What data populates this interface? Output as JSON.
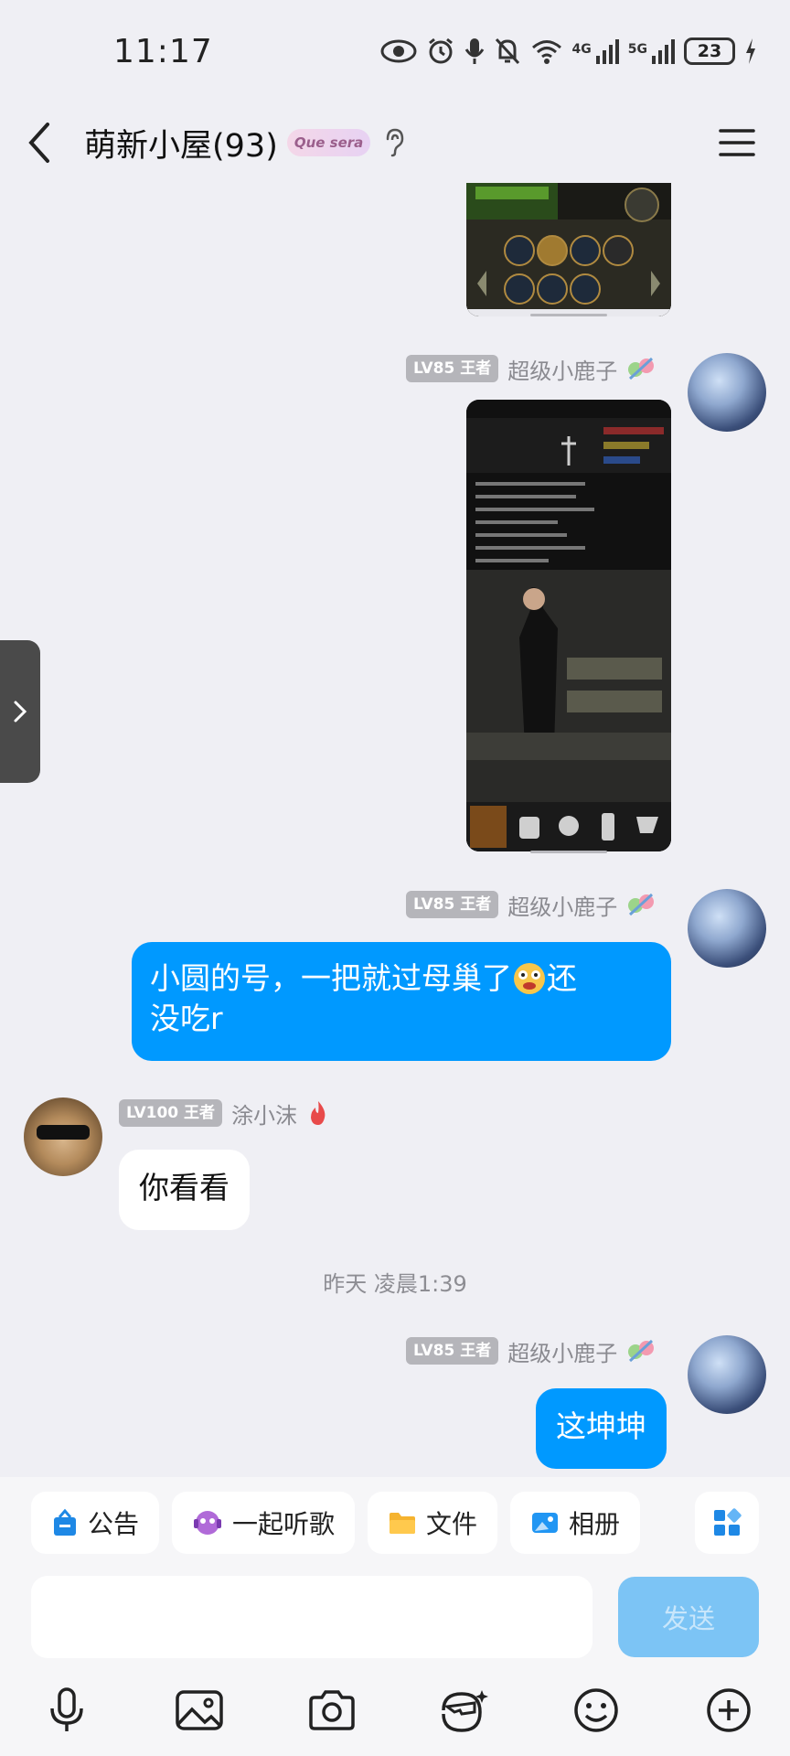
{
  "status_bar": {
    "time": "11:17",
    "network_1": "4G",
    "network_2": "5G",
    "battery": "23"
  },
  "header": {
    "back_icon": "chevron-left-icon",
    "title": "萌新小屋(93)",
    "badge_text": "Que sera",
    "ear_icon": "ear-icon",
    "menu_icon": "hamburger-menu-icon"
  },
  "messages": [
    {
      "type": "image",
      "direction": "out",
      "description_icon": "game-screenshot"
    },
    {
      "type": "image",
      "direction": "out",
      "level": "LV85 王者",
      "sender": "超级小鹿子"
    },
    {
      "type": "text",
      "direction": "out",
      "level": "LV85 王者",
      "sender": "超级小鹿子",
      "text_line1": "小圆的号，一把就过母巢了",
      "text_line1_end": "还",
      "text_line2": "没吃r"
    },
    {
      "type": "text",
      "direction": "in",
      "level": "LV100 王者",
      "sender": "涂小沫",
      "text": "你看看"
    },
    {
      "type": "time",
      "text": "昨天 凌晨1:39"
    },
    {
      "type": "text",
      "direction": "out",
      "level": "LV85 王者",
      "sender": "超级小鹿子",
      "text": "这坤坤"
    }
  ],
  "quick_bar": {
    "announcement": "公告",
    "listen_together": "一起听歌",
    "files": "文件",
    "album": "相册"
  },
  "input": {
    "placeholder": "",
    "send_label": "发送"
  },
  "toolbar": [
    "microphone-icon",
    "image-icon",
    "camera-icon",
    "sticker-ai-icon",
    "emoji-icon",
    "plus-icon"
  ],
  "colors": {
    "accent": "#0099ff",
    "background": "#efeff4",
    "send_disabled": "#7cc4f5"
  }
}
